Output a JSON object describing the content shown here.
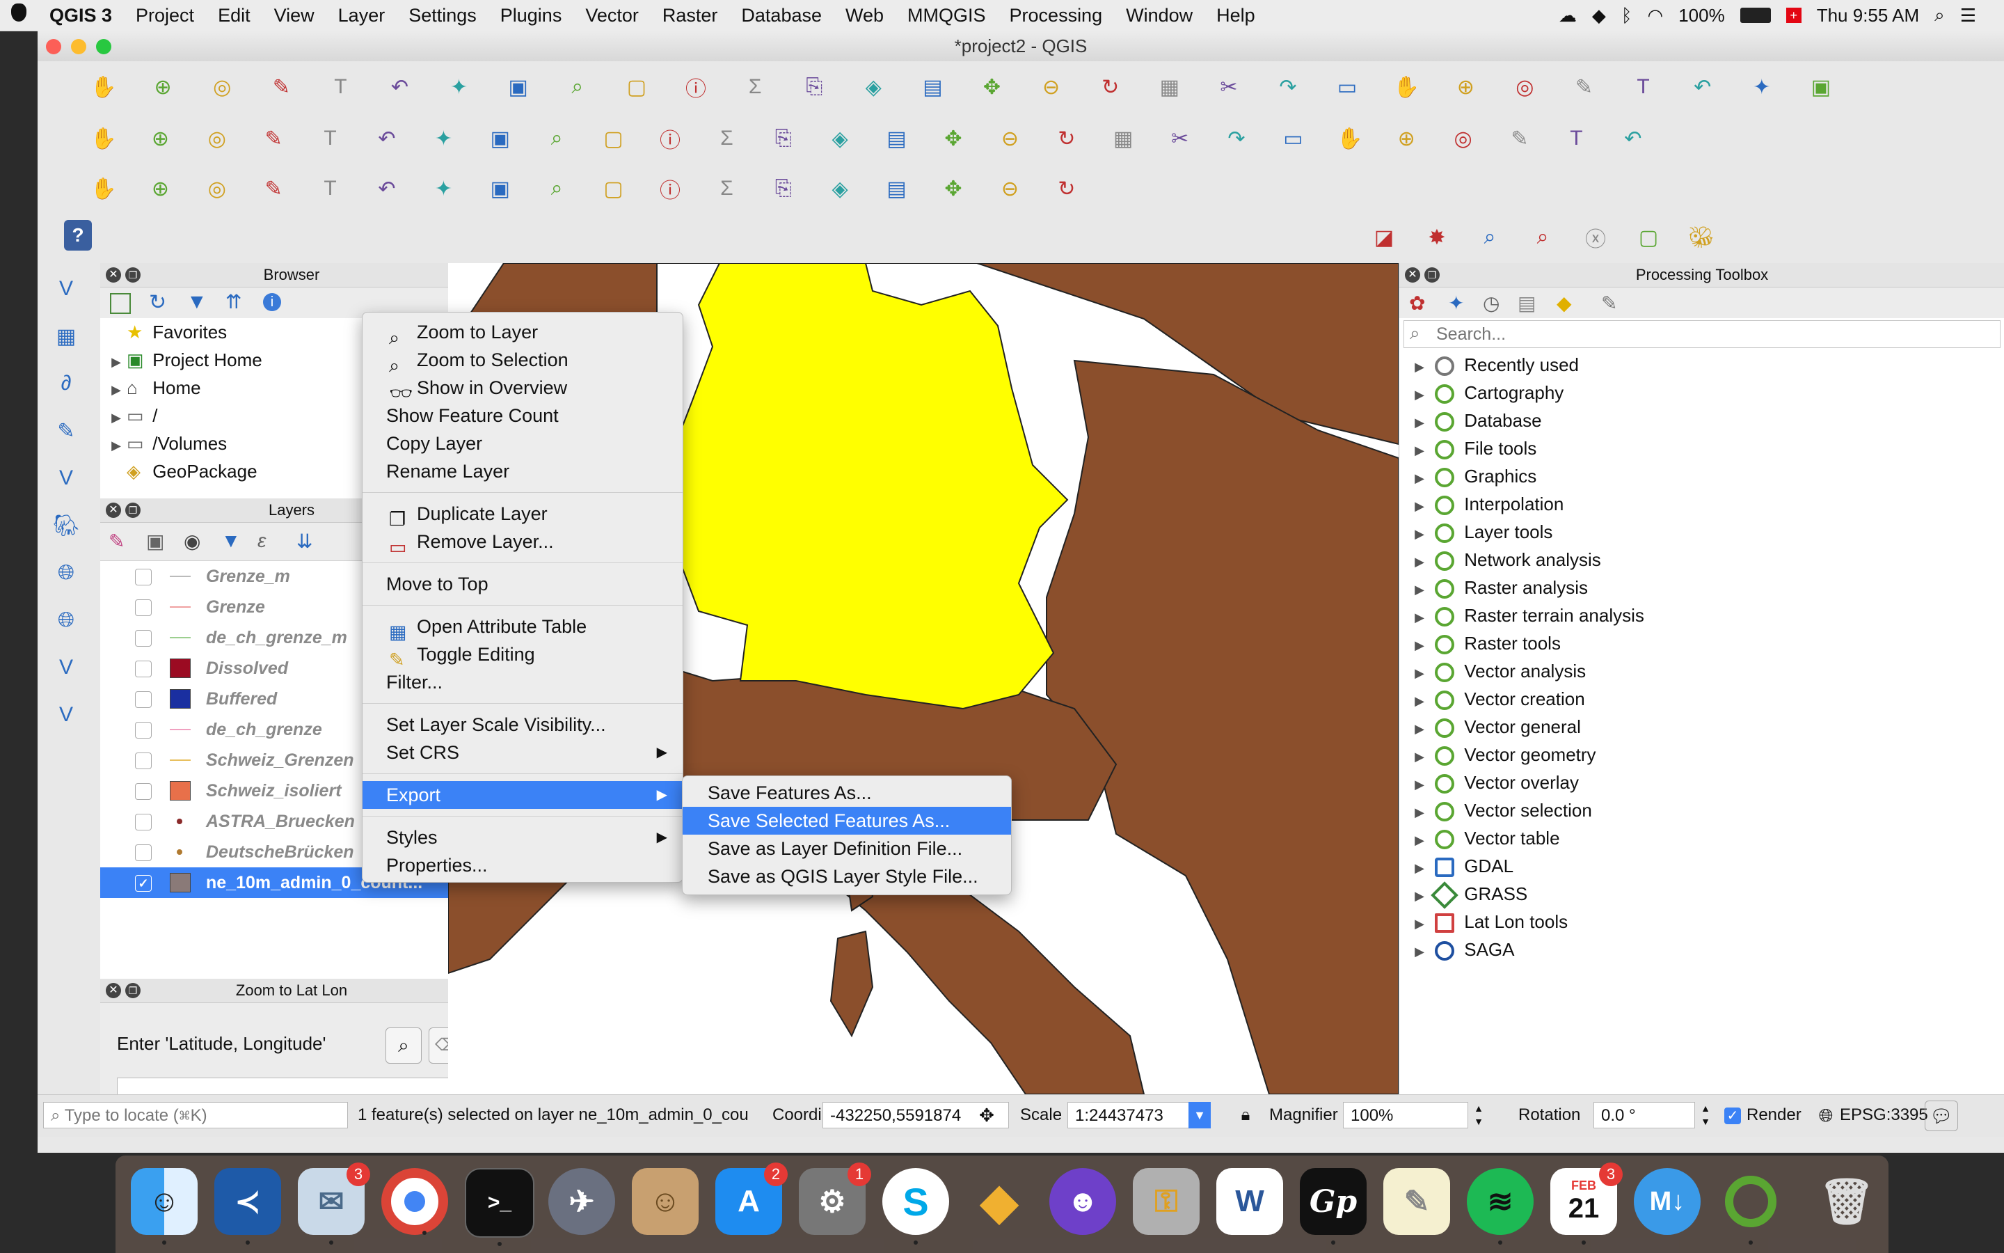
{
  "menubar": {
    "app": "QGIS 3",
    "items": [
      "Project",
      "Edit",
      "View",
      "Layer",
      "Settings",
      "Plugins",
      "Vector",
      "Raster",
      "Database",
      "Web",
      "MMQGIS",
      "Processing",
      "Window",
      "Help"
    ],
    "battery": "100%",
    "clock": "Thu 9:55 AM"
  },
  "window": {
    "title": "*project2 - QGIS"
  },
  "browser": {
    "title": "Browser",
    "items": [
      {
        "label": "Favorites"
      },
      {
        "label": "Project Home"
      },
      {
        "label": "Home"
      },
      {
        "label": "/"
      },
      {
        "label": "/Volumes"
      },
      {
        "label": "GeoPackage"
      }
    ]
  },
  "layers": {
    "title": "Layers",
    "items": [
      {
        "label": "Grenze_m",
        "color": "#bbbbbb"
      },
      {
        "label": "Grenze",
        "color": "#f0a0a0"
      },
      {
        "label": "de_ch_grenze_m",
        "color": "#9ccf8f"
      },
      {
        "label": "Dissolved",
        "color": "#9b0b22"
      },
      {
        "label": "Buffered",
        "color": "#1a2fa0"
      },
      {
        "label": "de_ch_grenze",
        "color": "#f0a0c0"
      },
      {
        "label": "Schweiz_Grenzen",
        "color": "#e8c060"
      },
      {
        "label": "Schweiz_isoliert",
        "color": "#e8704a"
      },
      {
        "label": "ASTRA_Bruecken",
        "color": "#8a2a2a"
      },
      {
        "label": "DeutscheBrücken",
        "color": "#b07a30"
      },
      {
        "label": "ne_10m_admin_0_count...",
        "color": "#8a7a78"
      }
    ]
  },
  "zoom_latlon": {
    "title": "Zoom to Lat Lon",
    "label": "Enter 'Latitude, Longitude'",
    "value": ""
  },
  "context_menu": {
    "zoom_layer": "Zoom to Layer",
    "zoom_selection": "Zoom to Selection",
    "show_overview": "Show in Overview",
    "feature_count": "Show Feature Count",
    "copy_layer": "Copy Layer",
    "rename_layer": "Rename Layer",
    "duplicate_layer": "Duplicate Layer",
    "remove_layer": "Remove Layer...",
    "move_top": "Move to Top",
    "attr_table": "Open Attribute Table",
    "toggle_editing": "Toggle Editing",
    "filter": "Filter...",
    "scale_visibility": "Set Layer Scale Visibility...",
    "set_crs": "Set CRS",
    "export": "Export",
    "styles": "Styles",
    "properties": "Properties..."
  },
  "export_submenu": {
    "save_features": "Save Features As...",
    "save_selected": "Save Selected Features As...",
    "save_qlr": "Save as Layer Definition File...",
    "save_qml": "Save as QGIS Layer Style File..."
  },
  "processing": {
    "title": "Processing Toolbox",
    "search_placeholder": "Search...",
    "items": [
      {
        "label": "Recently used",
        "icon": "clock-icon"
      },
      {
        "label": "Cartography",
        "icon": "qgis-icon"
      },
      {
        "label": "Database",
        "icon": "qgis-icon"
      },
      {
        "label": "File tools",
        "icon": "qgis-icon"
      },
      {
        "label": "Graphics",
        "icon": "qgis-icon"
      },
      {
        "label": "Interpolation",
        "icon": "qgis-icon"
      },
      {
        "label": "Layer tools",
        "icon": "qgis-icon"
      },
      {
        "label": "Network analysis",
        "icon": "qgis-icon"
      },
      {
        "label": "Raster analysis",
        "icon": "qgis-icon"
      },
      {
        "label": "Raster terrain analysis",
        "icon": "qgis-icon"
      },
      {
        "label": "Raster tools",
        "icon": "qgis-icon"
      },
      {
        "label": "Vector analysis",
        "icon": "qgis-icon"
      },
      {
        "label": "Vector creation",
        "icon": "qgis-icon"
      },
      {
        "label": "Vector general",
        "icon": "qgis-icon"
      },
      {
        "label": "Vector geometry",
        "icon": "qgis-icon"
      },
      {
        "label": "Vector overlay",
        "icon": "qgis-icon"
      },
      {
        "label": "Vector selection",
        "icon": "qgis-icon"
      },
      {
        "label": "Vector table",
        "icon": "qgis-icon"
      },
      {
        "label": "GDAL",
        "icon": "gdal-icon"
      },
      {
        "label": "GRASS",
        "icon": "grass-icon"
      },
      {
        "label": "Lat Lon tools",
        "icon": "latlon-icon"
      },
      {
        "label": "SAGA",
        "icon": "saga-icon"
      }
    ]
  },
  "statusbar": {
    "locate_placeholder": "Type to locate (⌘K)",
    "message": "1 feature(s) selected on layer ne_10m_admin_0_cou",
    "coordinate_label": "Coordinate",
    "coordinate": "-432250,5591874",
    "scale_label": "Scale",
    "scale": "1:24437473",
    "magnifier_label": "Magnifier",
    "magnifier": "100%",
    "rotation_label": "Rotation",
    "rotation": "0.0 °",
    "render_label": "Render",
    "crs": "EPSG:3395"
  },
  "dock": {
    "mail_badge": "3",
    "appstore_badge": "2",
    "prefs_badge": "1",
    "calendar_month": "FEB",
    "calendar_day": "21",
    "calendar_badge": "3"
  },
  "colors": {
    "map_land": "#8b4f2c",
    "germany": "#ffff00",
    "selection": "#3b82f6",
    "map_bg": "#ffffff"
  }
}
